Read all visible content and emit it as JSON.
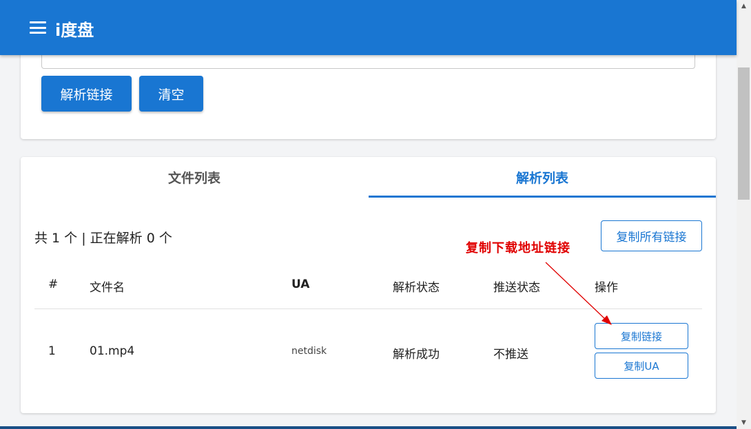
{
  "app": {
    "title": "i度盘"
  },
  "input_section": {
    "parse_button": "解析链接",
    "clear_button": "清空"
  },
  "tabs": [
    {
      "label": "文件列表",
      "active": false
    },
    {
      "label": "解析列表",
      "active": true
    }
  ],
  "summary": "共 1 个 | 正在解析 0 个",
  "copy_all_button": "复制所有链接",
  "table": {
    "headers": [
      "#",
      "文件名",
      "UA",
      "解析状态",
      "推送状态",
      "操作"
    ],
    "rows": [
      {
        "index": "1",
        "filename": "01.mp4",
        "ua": "netdisk",
        "parse_status": "解析成功",
        "push_status": "不推送",
        "actions": [
          "复制链接",
          "复制UA"
        ]
      }
    ]
  },
  "annotation": "复制下载地址链接",
  "colors": {
    "primary": "#1976d2",
    "annotation": "#e00000"
  },
  "icons": {
    "menu": "hamburger-menu-icon"
  }
}
